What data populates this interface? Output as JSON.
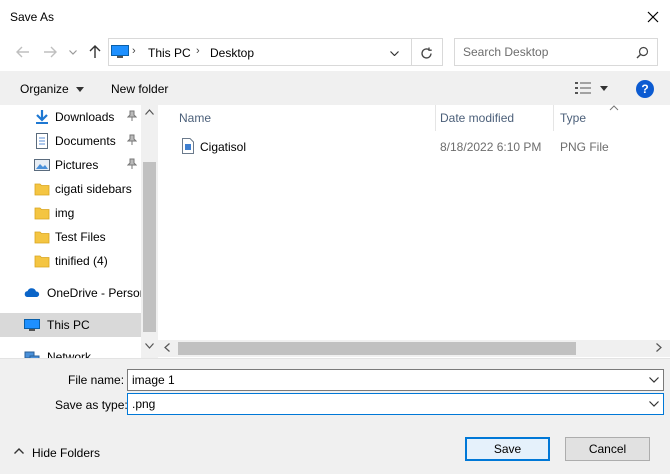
{
  "window": {
    "title": "Save As"
  },
  "address": {
    "crumbs": [
      "This PC",
      "Desktop"
    ],
    "search_placeholder": "Search Desktop"
  },
  "toolbar": {
    "organize_label": "Organize",
    "new_folder_label": "New folder"
  },
  "sidebar": {
    "items": [
      {
        "label": "Downloads",
        "icon": "downloads-icon",
        "pinned": true
      },
      {
        "label": "Documents",
        "icon": "documents-icon",
        "pinned": true
      },
      {
        "label": "Pictures",
        "icon": "pictures-icon",
        "pinned": true
      },
      {
        "label": "cigati sidebars",
        "icon": "folder-icon",
        "pinned": false
      },
      {
        "label": "img",
        "icon": "folder-icon",
        "pinned": false
      },
      {
        "label": "Test Files",
        "icon": "folder-icon",
        "pinned": false
      },
      {
        "label": "tinified (4)",
        "icon": "folder-icon",
        "pinned": false
      },
      {
        "label": "OneDrive - Persor",
        "icon": "onedrive-icon",
        "pinned": false
      },
      {
        "label": "This PC",
        "icon": "this-pc-icon",
        "pinned": false,
        "selected": true
      },
      {
        "label": "Network",
        "icon": "network-icon",
        "pinned": false
      }
    ]
  },
  "file_list": {
    "columns": [
      "Name",
      "Date modified",
      "Type"
    ],
    "rows": [
      {
        "name": "Cigatisol",
        "date": "8/18/2022 6:10 PM",
        "type": "PNG File"
      }
    ]
  },
  "form": {
    "file_name_label": "File name:",
    "file_name_value": "image 1",
    "save_type_label": "Save as type:",
    "save_type_value": ".png"
  },
  "footer": {
    "hide_folders_label": "Hide Folders",
    "save_label": "Save",
    "cancel_label": "Cancel"
  },
  "colors": {
    "accent": "#0078d7",
    "selection": "#d9d9d9",
    "toolbar_bg": "#f0f0f0",
    "folder": "#f4c542"
  }
}
